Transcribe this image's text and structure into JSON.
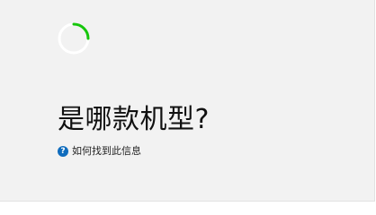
{
  "page": {
    "title": "是哪款机型?",
    "help_link_text": "如何找到此信息",
    "help_icon": {
      "name": "question-circle-icon",
      "glyph": "?"
    }
  },
  "loading": {
    "icon": "spinner-icon",
    "progress_fraction": 0.25
  },
  "colors": {
    "background": "#f2f2f2",
    "spinner_accent": "#16c60c",
    "spinner_track": "#ffffff",
    "help_icon": "#0f6cbd",
    "title_text": "#111111"
  }
}
